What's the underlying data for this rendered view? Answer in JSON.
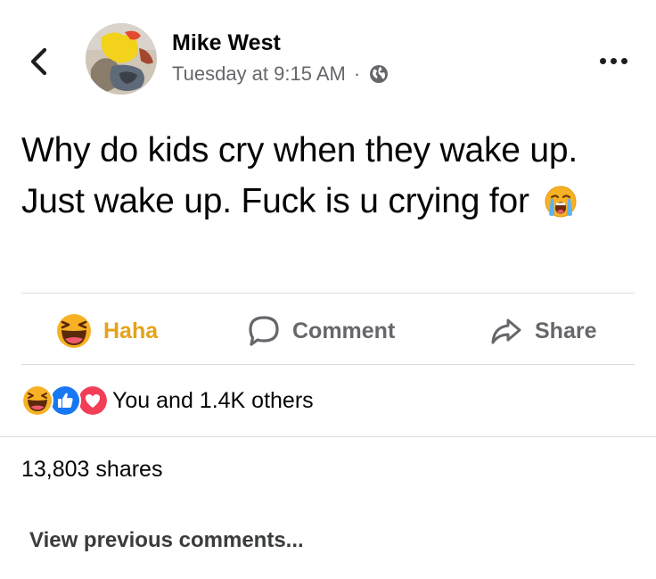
{
  "header": {
    "back_icon": "chevron-left-icon",
    "author_name": "Mike West",
    "timestamp": "Tuesday at 9:15 AM",
    "separator": "·",
    "privacy_icon": "globe-icon",
    "more_icon": "more-horizontal-icon"
  },
  "post": {
    "text": "Why do kids cry when they wake up. Just wake up. Fuck is u crying for",
    "emoji_icon": "loudly-crying-face-emoji"
  },
  "actions": {
    "haha": {
      "label": "Haha",
      "icon": "haha-emoji-icon",
      "color": "#e5a21a"
    },
    "comment": {
      "label": "Comment",
      "icon": "comment-bubble-icon"
    },
    "share": {
      "label": "Share",
      "icon": "share-arrow-icon"
    }
  },
  "reactions": {
    "icons": [
      "haha-reaction-icon",
      "like-reaction-icon",
      "love-reaction-icon"
    ],
    "label": "You and 1.4K others"
  },
  "shares": {
    "label": "13,803 shares"
  },
  "comments": {
    "view_previous_label": "View previous comments..."
  },
  "colors": {
    "text_primary": "#050505",
    "text_secondary": "#65676b",
    "divider": "#dcdde1",
    "like_blue": "#1877f2",
    "love_red": "#f33e58",
    "haha_yellow": "#f7b125"
  }
}
